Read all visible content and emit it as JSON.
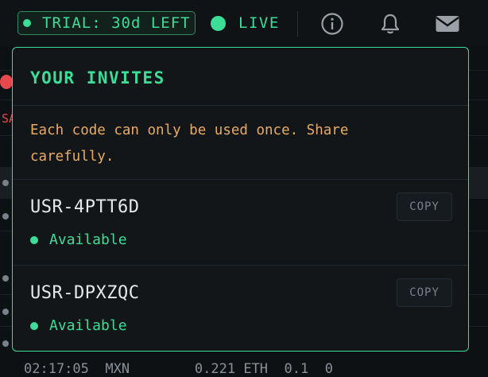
{
  "header": {
    "trial_label": "TRIAL: 30d LEFT",
    "live_label": "LIVE",
    "icons": [
      "info-icon",
      "bell-icon",
      "mail-icon"
    ]
  },
  "background": {
    "red_text": "SA",
    "bottom_text": "02:17:05  MXN        0.221 ETH  0.1  0"
  },
  "invites_popover": {
    "title": "YOUR INVITES",
    "warning": "Each code can only be used once. Share carefully.",
    "copy_label": "COPY",
    "invites": [
      {
        "code": "USR-4PTT6D",
        "status": "Available"
      },
      {
        "code": "USR-DPXZQC",
        "status": "Available"
      }
    ]
  },
  "colors": {
    "accent": "#3ddc97",
    "warning": "#e8ab66",
    "danger": "#e5484d",
    "background": "#0e1114",
    "panel": "#121619"
  }
}
